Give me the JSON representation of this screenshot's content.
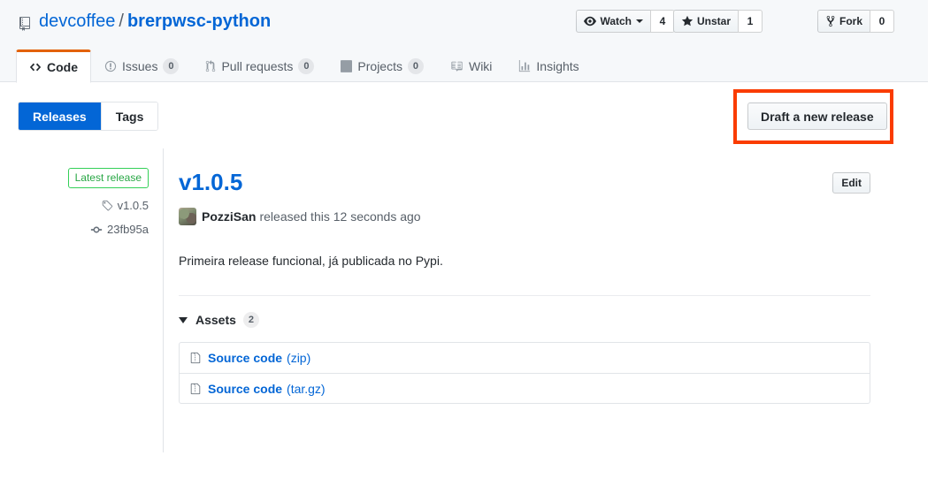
{
  "header": {
    "repo_icon": "repo-icon",
    "owner": "devcoffee",
    "separator": "/",
    "repo": "brerpwsc-python",
    "social": [
      {
        "name": "watch",
        "icon": "eye-icon",
        "label": "Watch",
        "count": "4",
        "has_caret": true
      },
      {
        "name": "star",
        "icon": "star-icon",
        "label": "Unstar",
        "count": "1",
        "has_caret": false
      },
      {
        "name": "fork",
        "icon": "fork-icon",
        "label": "Fork",
        "count": "0",
        "has_caret": false
      }
    ],
    "nav": [
      {
        "name": "code",
        "icon": "code-icon",
        "label": "Code",
        "count": null,
        "selected": true
      },
      {
        "name": "issues",
        "icon": "issue-icon",
        "label": "Issues",
        "count": "0",
        "selected": false
      },
      {
        "name": "pull-requests",
        "icon": "git-pull-icon",
        "label": "Pull requests",
        "count": "0",
        "selected": false
      },
      {
        "name": "projects",
        "icon": "project-icon",
        "label": "Projects",
        "count": "0",
        "selected": false
      },
      {
        "name": "wiki",
        "icon": "book-icon",
        "label": "Wiki",
        "count": null,
        "selected": false
      },
      {
        "name": "insights",
        "icon": "graph-icon",
        "label": "Insights",
        "count": null,
        "selected": false
      }
    ]
  },
  "subnav": {
    "releases_label": "Releases",
    "tags_label": "Tags",
    "draft_button_label": "Draft a new release",
    "annotation_color": "#fa3c00"
  },
  "sidebar": {
    "latest_badge": "Latest release",
    "tag_icon": "tag-icon",
    "tag": "v1.0.5",
    "commit_icon": "git-commit-icon",
    "commit": "23fb95a"
  },
  "release": {
    "title": "v1.0.5",
    "edit_label": "Edit",
    "avatar_icon": "avatar",
    "author": "PozziSan",
    "released_text": "released this 12 seconds ago",
    "body": "Primeira release funcional, já publicada no Pypi.",
    "assets_label": "Assets",
    "assets_count": "2",
    "assets": [
      {
        "icon": "file-zip-icon",
        "name": "Source code",
        "ext": "(zip)"
      },
      {
        "icon": "file-zip-icon",
        "name": "Source code",
        "ext": "(tar.gz)"
      }
    ]
  },
  "colors": {
    "link": "#0366d6",
    "accent_orange": "#e36209",
    "success_green": "#28a745",
    "header_bg": "#f6f8fa",
    "border": "#e1e4e8"
  }
}
